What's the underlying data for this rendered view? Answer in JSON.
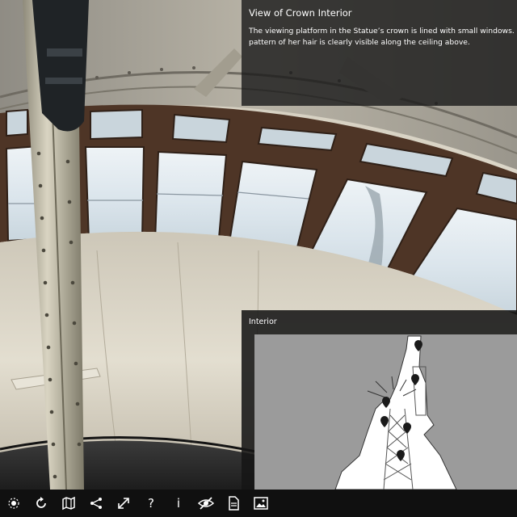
{
  "info_panel": {
    "title": "View of Crown Interior",
    "lines": [
      "The viewing platform in the Statue’s crown is lined with small windows.",
      "pattern of her hair is clearly visible along the ceiling above."
    ]
  },
  "map_panel": {
    "title": "Interior",
    "markers": 6
  },
  "toolbar": {
    "buttons": [
      {
        "name": "gyro-button",
        "icon": "gyroscope-icon"
      },
      {
        "name": "autorotate-button",
        "icon": "rotate-icon"
      },
      {
        "name": "map-button",
        "icon": "map-icon"
      },
      {
        "name": "share-button",
        "icon": "share-icon"
      },
      {
        "name": "fullscreen-button",
        "icon": "expand-icon"
      },
      {
        "name": "help-button",
        "icon": "question-icon",
        "label": "?"
      },
      {
        "name": "info-button",
        "icon": "info-icon",
        "label": "i"
      },
      {
        "name": "hide-hotspots-button",
        "icon": "eye-slash-icon"
      },
      {
        "name": "document-button",
        "icon": "document-icon"
      },
      {
        "name": "gallery-button",
        "icon": "image-icon"
      }
    ]
  },
  "colors": {
    "panel_bg": "#1c1c1c",
    "toolbar_bg": "#101010",
    "map_bg": "#9b9b9b",
    "window_glass": "#dfe9ef",
    "window_frame": "#5a3d2c"
  }
}
